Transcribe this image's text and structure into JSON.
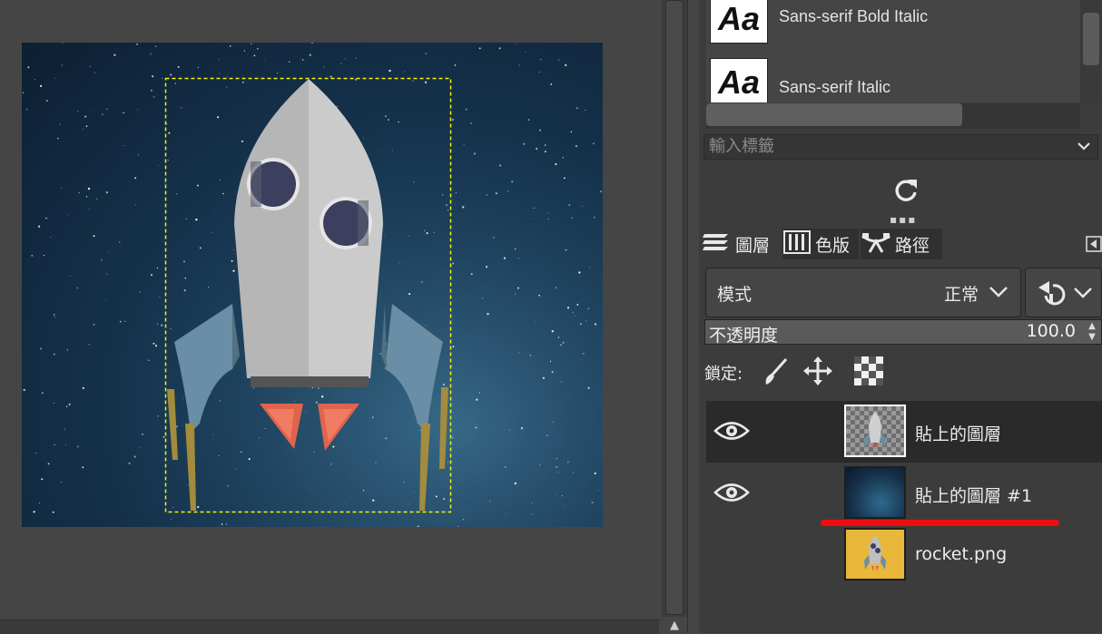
{
  "font_list": {
    "items": [
      {
        "preview": "Aa",
        "name": "Sans-serif Bold Italic"
      },
      {
        "preview": "Aa",
        "name": "Sans-serif Italic"
      }
    ],
    "tag_input_placeholder": "輸入標籤"
  },
  "tabs": [
    {
      "label": "圖層",
      "icon": "layers-icon"
    },
    {
      "label": "色版",
      "icon": "channels-icon"
    },
    {
      "label": "路徑",
      "icon": "paths-icon"
    }
  ],
  "layers_panel": {
    "mode_label": "模式",
    "mode_value": "正常",
    "opacity_label": "不透明度",
    "opacity_value": "100.0",
    "opacity_fraction": 1.0,
    "lock_label": "鎖定:"
  },
  "layers": [
    {
      "name": "貼上的圖層",
      "visible": true,
      "selected": true
    },
    {
      "name": "貼上的圖層 #1",
      "visible": true,
      "selected": false
    },
    {
      "name": "rocket.png",
      "visible": false,
      "selected": false
    }
  ],
  "colors": {
    "annotation_underline": "#ee0e0e",
    "selection_marquee": "#f5f500",
    "rocket_thumb_bg": "#e9b83b"
  }
}
